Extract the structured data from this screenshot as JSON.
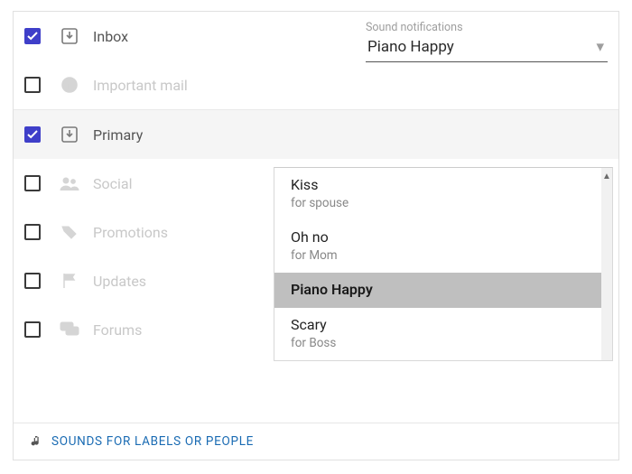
{
  "sound_select": {
    "label": "Sound notifications",
    "value": "Piano Happy"
  },
  "rows": {
    "inbox": {
      "label": "Inbox",
      "checked": true,
      "active": true,
      "icon": "inbox-download-icon"
    },
    "important": {
      "label": "Important mail",
      "checked": false,
      "active": false,
      "icon": "info-circle-icon"
    },
    "primary": {
      "label": "Primary",
      "checked": true,
      "active": true,
      "icon": "inbox-download-icon"
    },
    "social": {
      "label": "Social",
      "checked": false,
      "active": false,
      "icon": "people-icon"
    },
    "promotions": {
      "label": "Promotions",
      "checked": false,
      "active": false,
      "icon": "tag-icon"
    },
    "updates": {
      "label": "Updates",
      "checked": false,
      "active": false,
      "icon": "flag-icon"
    },
    "forums": {
      "label": "Forums",
      "checked": false,
      "active": false,
      "icon": "chat-icon"
    }
  },
  "menu": {
    "items": [
      {
        "name": "Kiss",
        "sub": "for spouse",
        "selected": false
      },
      {
        "name": "Oh no",
        "sub": "for Mom",
        "selected": false
      },
      {
        "name": "Piano Happy",
        "sub": "",
        "selected": true
      },
      {
        "name": "Scary",
        "sub": "for Boss",
        "selected": false
      }
    ]
  },
  "footer": {
    "link": "Sounds for labels or people"
  }
}
